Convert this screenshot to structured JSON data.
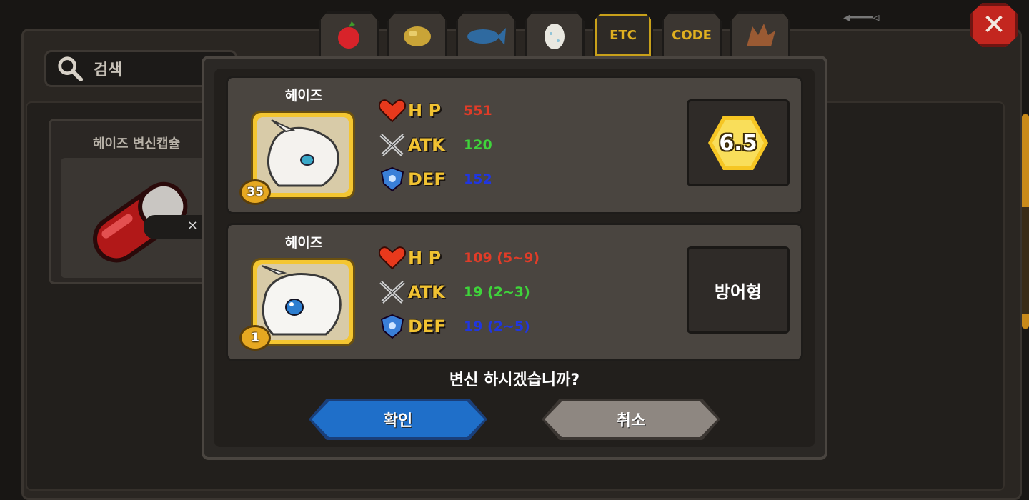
{
  "search": {
    "label": "검색"
  },
  "item": {
    "title": "헤이즈 변신캡슐",
    "count_prefix": "×"
  },
  "tabs": [
    {
      "icon": "fruit-icon"
    },
    {
      "icon": "ore-icon"
    },
    {
      "icon": "fish-icon"
    },
    {
      "icon": "egg-icon"
    },
    {
      "label": "ETC",
      "active": true
    },
    {
      "label": "CODE"
    },
    {
      "icon": "dragon-icon"
    }
  ],
  "current": {
    "name": "헤이즈",
    "level": "35",
    "hp": "551",
    "atk": "120",
    "def": "152",
    "grade": "6.5"
  },
  "result": {
    "name": "헤이즈",
    "level": "1",
    "hp": "109 (5~9)",
    "atk": "19 (2~3)",
    "def": "19 (2~5)",
    "type": "방어형"
  },
  "stat_labels": {
    "hp": "H P",
    "atk": "ATK",
    "def": "DEF"
  },
  "question": "변신 하시겠습니까?",
  "buttons": {
    "confirm": "확인",
    "cancel": "취소"
  },
  "close_label": "✕",
  "colors": {
    "hp": "#e03c28",
    "atk": "#3fd43b",
    "def": "#2036e0",
    "stat_label": "#f1c232",
    "confirm_button": "#1f6fc9",
    "cancel_button": "#8e8781"
  }
}
